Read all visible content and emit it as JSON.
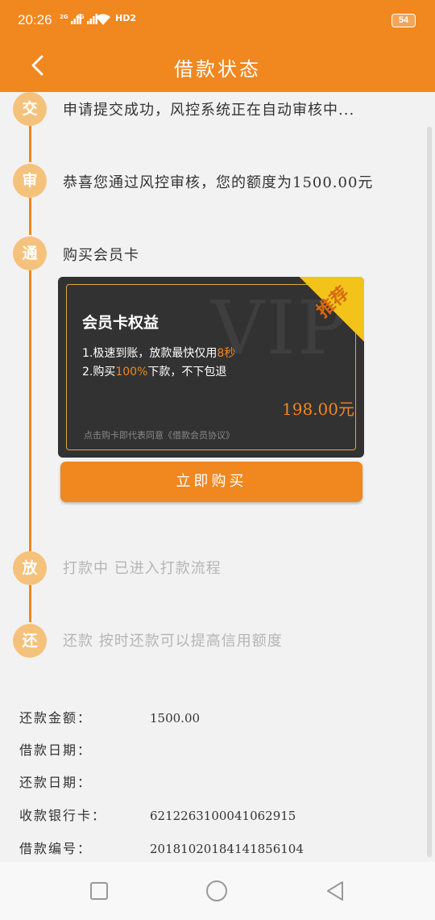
{
  "status_bar": {
    "time": "20:26",
    "signal1": "2G",
    "signal2": "4G",
    "network": "HD2",
    "battery": "54"
  },
  "header": {
    "title": "借款状态"
  },
  "steps": [
    {
      "icon": "交",
      "text": "申请提交成功，风控系统正在自动审核中...",
      "state": "active"
    },
    {
      "icon": "审",
      "text": "恭喜您通过风控审核，您的额度为1500.00元",
      "state": "active"
    },
    {
      "icon": "通",
      "text": "购买会员卡",
      "state": "active"
    },
    {
      "icon": "放",
      "text": "打款中 已进入打款流程",
      "state": "pending"
    },
    {
      "icon": "还",
      "text": "还款 按时还款可以提高信用额度",
      "state": "pending"
    }
  ],
  "vip_card": {
    "watermark": "VIP",
    "title": "会员卡权益",
    "line1_prefix": "1.极速到账，放款最快仅用",
    "line1_highlight": "8秒",
    "line2_prefix": "2.购买",
    "line2_highlight": "100%",
    "line2_suffix": "下款，不下包退",
    "price": "198.00元",
    "agreement": "点击购卡即代表同意《借款会员协议》",
    "badge": "推荐"
  },
  "buy_button": "立即购买",
  "info": [
    {
      "label": "还款金额：",
      "value": "1500.00"
    },
    {
      "label": "借款日期：",
      "value": ""
    },
    {
      "label": "还款日期：",
      "value": ""
    },
    {
      "label": "收款银行卡：",
      "value": "6212263100041062915"
    },
    {
      "label": "借款编号：",
      "value": "20181020184141856104"
    }
  ],
  "colors": {
    "primary": "#f0871f",
    "step_circle": "#f5c27c",
    "card_bg": "#333232",
    "card_border": "#e0a93a",
    "badge": "#f3c31a"
  }
}
